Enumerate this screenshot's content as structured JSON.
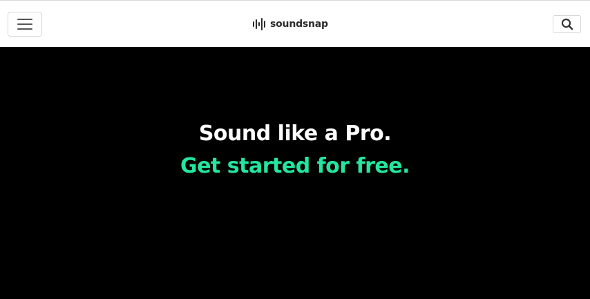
{
  "header": {
    "menu_icon": "hamburger-icon",
    "logo_icon": "waveform-icon",
    "logo_text": "soundsnap",
    "search_icon": "search-icon"
  },
  "hero": {
    "title": "Sound like a Pro.",
    "subtitle": "Get started for free."
  },
  "colors": {
    "accent": "#23e6a0",
    "hero_background": "#000000",
    "header_background": "#ffffff"
  }
}
